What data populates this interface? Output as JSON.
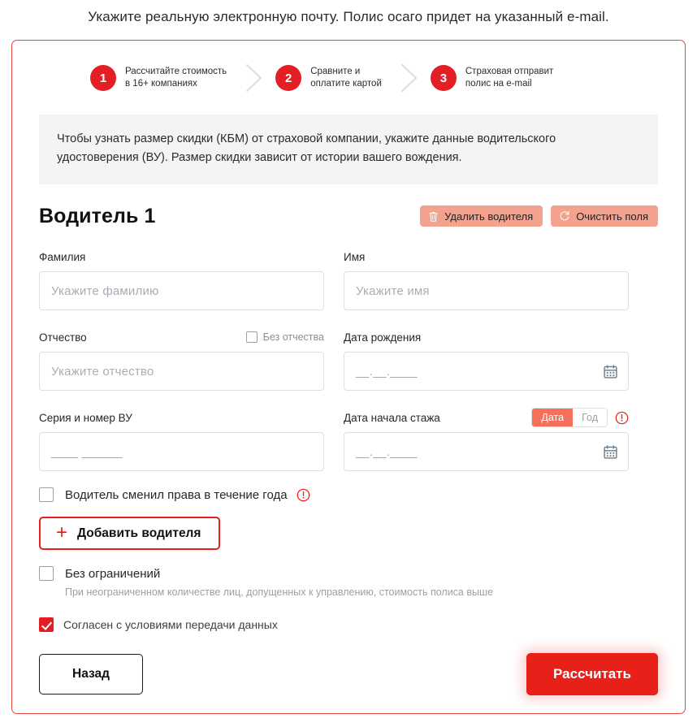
{
  "notice": "Укажите реальную электронную почту. Полис осаго придет на указанный e-mail.",
  "steps": [
    {
      "num": "1",
      "text": "Рассчитайте стоимость\nв 16+ компаниях"
    },
    {
      "num": "2",
      "text": "Сравните и\nоплатите картой"
    },
    {
      "num": "3",
      "text": "Страховая отправит\nполис на e-mail"
    }
  ],
  "info_banner": "Чтобы узнать размер скидки (КБМ) от страховой компании, укажите данные водительского удостоверения (ВУ). Размер скидки зависит от истории вашего вождения.",
  "driver": {
    "title": "Водитель 1",
    "delete_label": "Удалить водителя",
    "clear_label": "Очистить поля",
    "delete_icon": "trash-icon",
    "clear_icon": "refresh-icon"
  },
  "fields": {
    "lastname": {
      "label": "Фамилия",
      "placeholder": "Укажите фамилию",
      "value": ""
    },
    "firstname": {
      "label": "Имя",
      "placeholder": "Укажите имя",
      "value": ""
    },
    "patronymic": {
      "label": "Отчество",
      "placeholder": "Укажите отчество",
      "value": "",
      "no_patronymic_label": "Без отчества"
    },
    "birthdate": {
      "label": "Дата рождения",
      "mask": "__.__.____",
      "icon": "calendar-icon"
    },
    "license": {
      "label": "Серия и номер ВУ",
      "mask": "____ ______"
    },
    "experience": {
      "label": "Дата начала стажа",
      "mask": "__.__.____",
      "icon": "calendar-icon",
      "toggle_date": "Дата",
      "toggle_year": "Год",
      "toggle_selected": "Дата",
      "warn_icon": "info-alert-icon"
    }
  },
  "options": {
    "changed_license_label": "Водитель сменил права в течение года",
    "changed_license_warn_icon": "info-alert-icon",
    "add_driver_label": "Добавить водителя",
    "add_driver_icon": "plus-icon",
    "unlimited_label": "Без ограничений",
    "unlimited_hint": "При неограниченном количестве лиц, допущенных к управлению, стоимость полиса выше",
    "agree_label": "Согласен с условиями передачи данных",
    "agree_checked": true
  },
  "footer": {
    "back_label": "Назад",
    "calc_label": "Рассчитать"
  },
  "colors": {
    "brand_red": "#e31e24",
    "button_red": "#e8201a",
    "salmon": "#f4a18d",
    "toggle_active": "#f4705a",
    "banner_bg": "#f3f4f6",
    "border_gray": "#dcdfe3",
    "muted_text": "#9aa0a6"
  }
}
